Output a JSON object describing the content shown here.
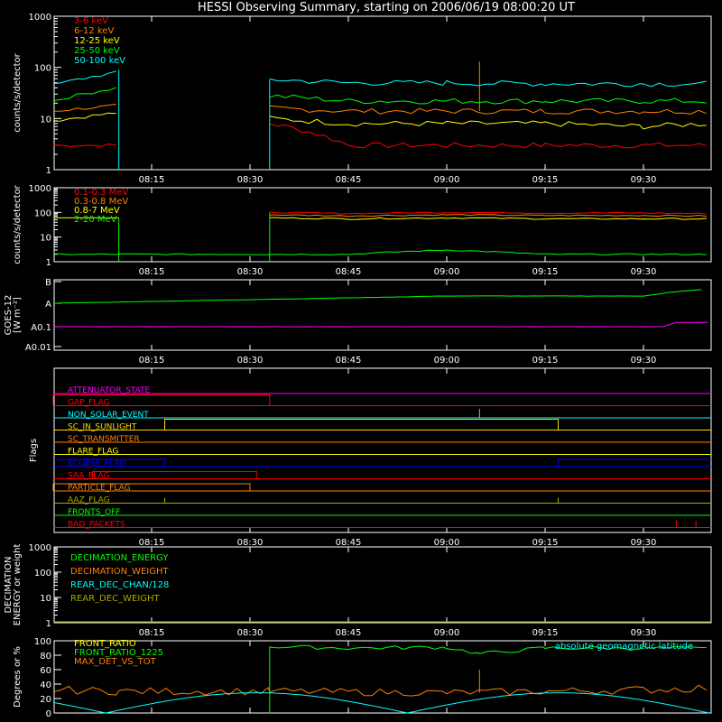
{
  "title": "HESSI Observing Summary, starting on 2006/06/19 08:00:20 UT",
  "time_labels": [
    "08:15",
    "08:30",
    "08:45",
    "09:00",
    "09:15",
    "09:30"
  ],
  "colors": {
    "axis": "#ffffff",
    "red": "#ff0000",
    "orange": "#ff7f00",
    "yellow": "#ffff00",
    "green": "#00ff00",
    "cyan": "#00ffff",
    "magenta": "#ff00ff",
    "blue": "#0000ff",
    "gold": "#ffd700",
    "olive": "#aaaa00"
  },
  "chart_data": [
    {
      "id": "lowE",
      "type": "line",
      "ylabel": "counts/s/detector",
      "yscale": "log",
      "ylim": [
        1,
        1000
      ],
      "y_ticks": [
        "1",
        "10",
        "100",
        "1000"
      ],
      "legend": [
        "3-6 keV",
        "6-12 keV",
        "12-25 keV",
        "25-50 keV",
        "50-100 keV"
      ],
      "series": [
        {
          "name": "3-6 keV",
          "color": "red",
          "x": [
            "08:00",
            "08:10",
            "08:33",
            "08:45",
            "09:00",
            "09:15",
            "09:30",
            "09:40"
          ],
          "y": [
            3,
            3,
            8,
            3,
            3,
            3,
            3,
            3
          ]
        },
        {
          "name": "6-12 keV",
          "color": "orange",
          "x": [
            "08:00",
            "08:10",
            "08:33",
            "08:45",
            "09:00",
            "09:15",
            "09:30",
            "09:40"
          ],
          "y": [
            14,
            18,
            16,
            14,
            14,
            14,
            14,
            14
          ]
        },
        {
          "name": "12-25 keV",
          "color": "yellow",
          "x": [
            "08:00",
            "08:10",
            "08:33",
            "08:45",
            "09:00",
            "09:15",
            "09:30",
            "09:40"
          ],
          "y": [
            9,
            13,
            10,
            8,
            8,
            8,
            7,
            8
          ]
        },
        {
          "name": "25-50 keV",
          "color": "green",
          "x": [
            "08:00",
            "08:10",
            "08:33",
            "08:45",
            "09:00",
            "09:15",
            "09:30",
            "09:40"
          ],
          "y": [
            22,
            40,
            28,
            22,
            22,
            22,
            22,
            22
          ]
        },
        {
          "name": "50-100 keV",
          "color": "cyan",
          "x": [
            "08:00",
            "08:10",
            "08:33",
            "08:45",
            "09:00",
            "09:15",
            "09:30",
            "09:40"
          ],
          "y": [
            45,
            80,
            58,
            50,
            50,
            48,
            48,
            48
          ]
        }
      ]
    },
    {
      "id": "highE",
      "type": "line",
      "ylabel": "counts/s/detector",
      "yscale": "log",
      "ylim": [
        1,
        1000
      ],
      "y_ticks": [
        "1",
        "10",
        "100",
        "1000"
      ],
      "legend": [
        "0.1-0.3 MeV",
        "0.3-0.8 MeV",
        "0.8-7 MeV",
        "2-20 MeV"
      ],
      "series": [
        {
          "name": "0.1-0.3 MeV",
          "color": "red",
          "x": [
            "08:33",
            "08:45",
            "09:00",
            "09:15",
            "09:30",
            "09:40"
          ],
          "y": [
            100,
            90,
            100,
            95,
            95,
            90
          ]
        },
        {
          "name": "0.3-0.8 MeV",
          "color": "orange",
          "x": [
            "08:33",
            "08:45",
            "09:00",
            "09:15",
            "09:30",
            "09:40"
          ],
          "y": [
            80,
            72,
            80,
            75,
            75,
            72
          ]
        },
        {
          "name": "0.8-7 MeV",
          "color": "yellow",
          "x": [
            "08:33",
            "08:45",
            "09:00",
            "09:15",
            "09:30",
            "09:40"
          ],
          "y": [
            60,
            55,
            60,
            55,
            55,
            55
          ]
        },
        {
          "name": "2-20 MeV",
          "color": "green",
          "x": [
            "08:00",
            "08:10",
            "08:33",
            "08:45",
            "09:00",
            "09:15",
            "09:30",
            "09:40"
          ],
          "y": [
            2,
            2,
            2,
            2,
            3,
            2,
            2,
            2
          ]
        }
      ]
    },
    {
      "id": "goes",
      "type": "line",
      "ylabel": "GOES-12 [W m⁻²]",
      "yscale": "log",
      "y_ticks": [
        "A0.01",
        "A0.1",
        "A",
        "B"
      ],
      "series": [
        {
          "name": "long",
          "color": "green",
          "x": [
            "08:00",
            "09:00",
            "09:30",
            "09:34",
            "09:40"
          ],
          "y": [
            0.6,
            0.8,
            0.8,
            0.9,
            1.0
          ]
        },
        {
          "name": "short",
          "color": "magenta",
          "x": [
            "08:00",
            "09:00",
            "09:33",
            "09:35",
            "09:40"
          ],
          "y": [
            0.1,
            0.1,
            0.1,
            0.13,
            0.13
          ]
        }
      ]
    },
    {
      "id": "flags",
      "type": "line",
      "ylabel": "Flags",
      "flags": [
        {
          "name": "ATTENUATOR_STATE",
          "color": "magenta"
        },
        {
          "name": "GAP_FLAG",
          "color": "red"
        },
        {
          "name": "NON_SOLAR_EVENT",
          "color": "cyan"
        },
        {
          "name": "SC_IN_SUNLIGHT",
          "color": "gold"
        },
        {
          "name": "SC_TRANSMITTER",
          "color": "orange"
        },
        {
          "name": "FLARE_FLAG",
          "color": "yellow"
        },
        {
          "name": "ECLIPSE_FLAG",
          "color": "blue"
        },
        {
          "name": "SAA_FLAG",
          "color": "red"
        },
        {
          "name": "PARTICLE_FLAG",
          "color": "orange"
        },
        {
          "name": "AAZ_FLAG",
          "color": "olive"
        },
        {
          "name": "FRONTS_OFF",
          "color": "green"
        },
        {
          "name": "BAD_PACKETS",
          "color": "red"
        }
      ]
    },
    {
      "id": "decim",
      "type": "line",
      "ylabel": "DECIMATION ENERGY or weight",
      "yscale": "log",
      "ylim": [
        1,
        1000
      ],
      "y_ticks": [
        "1",
        "10",
        "100",
        "1000"
      ],
      "legend": [
        "DECIMATION_ENERGY",
        "DECIMATION_WEIGHT",
        "REAR_DEC_CHAN/128",
        "REAR_DEC_WEIGHT"
      ]
    },
    {
      "id": "ratio",
      "type": "line",
      "ylabel": "Degrees or %",
      "ylim": [
        0,
        100
      ],
      "y_ticks": [
        "0",
        "20",
        "40",
        "60",
        "80",
        "100"
      ],
      "legend": [
        "FRONT_RATIO",
        "FRONT_RATIO_1225",
        "MAX_DET_VS_TOT"
      ],
      "annotation": "absolute geomagnetic latitude",
      "series": [
        {
          "name": "FRONT_RATIO",
          "color": "green",
          "x": [
            "08:33",
            "08:45",
            "09:00",
            "09:05",
            "09:15",
            "09:30",
            "09:40"
          ],
          "y": [
            92,
            90,
            91,
            82,
            90,
            90,
            89
          ]
        },
        {
          "name": "MAX_DET_VS_TOT",
          "color": "orange",
          "x": [
            "08:00",
            "08:10",
            "08:33",
            "09:00",
            "09:30",
            "09:40"
          ],
          "y": [
            32,
            30,
            30,
            28,
            32,
            35
          ]
        }
      ]
    }
  ]
}
